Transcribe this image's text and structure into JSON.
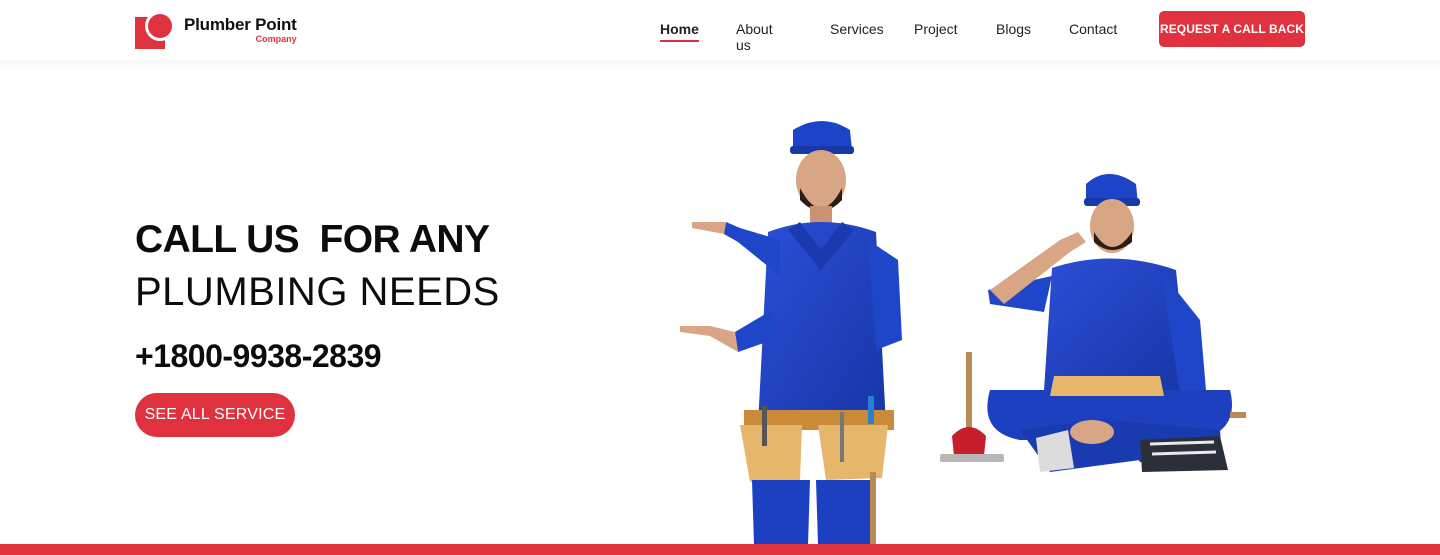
{
  "brand": {
    "name": "Plumber Point",
    "tagline": "Company",
    "accent_color": "#e0313f"
  },
  "nav": {
    "items": [
      {
        "label": "Home",
        "active": true
      },
      {
        "label": "About us",
        "active": false
      },
      {
        "label": "Services",
        "active": false
      },
      {
        "label": "Project",
        "active": false
      },
      {
        "label": "Blogs",
        "active": false
      },
      {
        "label": "Contact",
        "active": false
      }
    ],
    "cta_label": "REQUEST A CALL BACK"
  },
  "hero": {
    "headline_line1": "CALL US  FOR ANY",
    "headline_line2": "PLUMBING NEEDS",
    "phone": "+1800-9938-2839",
    "button_label": "SEE ALL SERVICE",
    "image": "two-plumbers-photo"
  }
}
